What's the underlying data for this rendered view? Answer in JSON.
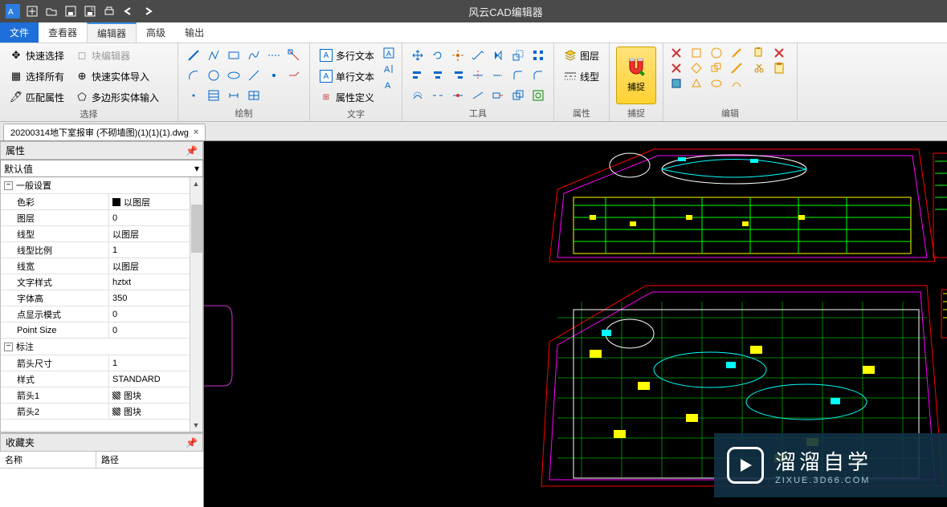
{
  "app": {
    "title": "风云CAD编辑器"
  },
  "qat_icons": [
    "app",
    "new",
    "open",
    "save",
    "saveas",
    "print",
    "undo",
    "redo"
  ],
  "menu": {
    "file": "文件",
    "viewer": "查看器",
    "editor": "编辑器",
    "advanced": "高级",
    "output": "输出"
  },
  "ribbon": {
    "select_group": {
      "label": "选择",
      "quick_select": "快速选择",
      "block_edit": "块编辑器",
      "select_all": "选择所有",
      "quick_import": "快速实体导入",
      "match_prop": "匹配属性",
      "poly_input": "多边形实体输入"
    },
    "draw_group": {
      "label": "绘制"
    },
    "text_group": {
      "label": "文字",
      "mtext": "多行文本",
      "dtext": "单行文本",
      "attdef": "属性定义"
    },
    "tool_group": {
      "label": "工具"
    },
    "prop_group": {
      "label": "属性",
      "layer": "图层",
      "linetype": "线型"
    },
    "snap_group": {
      "label": "捕捉",
      "snap_btn": "捕捉"
    },
    "edit_group": {
      "label": "编辑"
    }
  },
  "tab": {
    "filename": "20200314地下室报审 (不砌墙图)(1)(1)(1).dwg"
  },
  "props": {
    "panel_title": "属性",
    "default": "默认值",
    "sections": {
      "general": "一般设置",
      "annotate": "标注"
    },
    "rows": [
      {
        "k": "色彩",
        "v": "以图层",
        "swatch": true
      },
      {
        "k": "图层",
        "v": "0"
      },
      {
        "k": "线型",
        "v": "以图层"
      },
      {
        "k": "线型比例",
        "v": "1"
      },
      {
        "k": "线宽",
        "v": "以图层"
      },
      {
        "k": "文字样式",
        "v": "hztxt"
      },
      {
        "k": "字体高",
        "v": "350"
      },
      {
        "k": "点显示模式",
        "v": "0"
      },
      {
        "k": "Point Size",
        "v": "0"
      }
    ],
    "rows2": [
      {
        "k": "箭头尺寸",
        "v": "1"
      },
      {
        "k": "样式",
        "v": "STANDARD"
      },
      {
        "k": "箭头1",
        "v": "图块",
        "hatch": true
      },
      {
        "k": "箭头2",
        "v": "图块",
        "hatch": true
      }
    ]
  },
  "fav": {
    "title": "收藏夹",
    "col1": "名称",
    "col2": "路径"
  },
  "watermark": {
    "cn": "溜溜自学",
    "en": "ZIXUE.3D66.COM"
  }
}
